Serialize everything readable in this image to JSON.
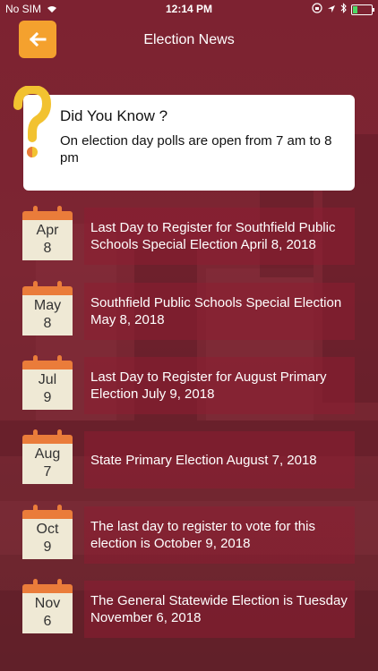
{
  "status_bar": {
    "carrier": "No SIM",
    "time": "12:14 PM"
  },
  "header": {
    "title": "Election News",
    "back_icon": "arrow-left-icon"
  },
  "did_you_know": {
    "title": "Did You Know ?",
    "body": "On election day polls are open from 7 am to 8 pm",
    "icon": "question-mark-icon"
  },
  "events": [
    {
      "month": "Apr",
      "day": "8",
      "text": "Last Day to Register for Southfield Public Schools Special Election April 8, 2018"
    },
    {
      "month": "May",
      "day": "8",
      "text": "Southfield Public Schools Special Election  May 8, 2018"
    },
    {
      "month": "Jul",
      "day": "9",
      "text": "Last Day to Register for August Primary Election July 9, 2018"
    },
    {
      "month": "Aug",
      "day": "7",
      "text": "State Primary Election August 7, 2018"
    },
    {
      "month": "Oct",
      "day": "9",
      "text": "The last day to register to vote for this election is October 9, 2018"
    },
    {
      "month": "Nov",
      "day": "6",
      "text": "The General Statewide Election is Tuesday November 6, 2018"
    }
  ],
  "colors": {
    "accent": "#f4a12e",
    "calendar_top": "#ea7c3a",
    "calendar_body": "#efe9d5",
    "background": "#7a2a35"
  }
}
